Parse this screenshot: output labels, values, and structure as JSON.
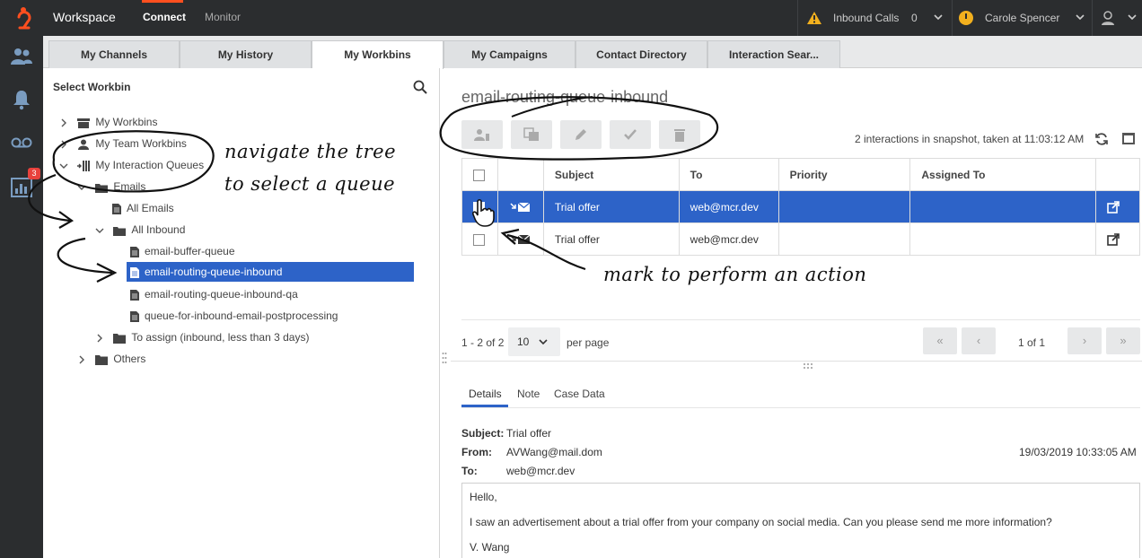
{
  "topbar": {
    "app_title": "Workspace",
    "tabs": [
      {
        "label": "Connect"
      },
      {
        "label": "Monitor"
      }
    ],
    "inbound_calls_label": "Inbound Calls",
    "inbound_calls_count": "0",
    "user_name": "Carole Spencer",
    "accent_color": "#ff4f1f"
  },
  "rail": {
    "icons": [
      "contacts-icon",
      "notifications-icon",
      "voicemail-icon",
      "dashboard-icon"
    ],
    "dashboard_badge": "3"
  },
  "workbin_tabs": [
    {
      "label": "My Channels"
    },
    {
      "label": "My History"
    },
    {
      "label": "My Workbins"
    },
    {
      "label": "My Campaigns"
    },
    {
      "label": "Contact Directory"
    },
    {
      "label": "Interaction Sear..."
    }
  ],
  "left_panel": {
    "title": "Select Workbin",
    "tree": [
      {
        "label": "My Workbins"
      },
      {
        "label": "My Team Workbins"
      },
      {
        "label": "My Interaction Queues"
      },
      {
        "label": "Emails"
      },
      {
        "label": "All Emails"
      },
      {
        "label": "All Inbound"
      },
      {
        "label": "email-buffer-queue"
      },
      {
        "label": "email-routing-queue-inbound"
      },
      {
        "label": "email-routing-queue-inbound-qa"
      },
      {
        "label": "queue-for-inbound-email-postprocessing"
      },
      {
        "label": "To assign (inbound, less than 3 days)"
      },
      {
        "label": "Others"
      }
    ]
  },
  "right_panel": {
    "title": "email-routing-queue-inbound",
    "snapshot_text": "2 interactions in snapshot, taken at 11:03:12 AM",
    "columns": [
      "Subject",
      "To",
      "Priority",
      "Assigned To"
    ],
    "rows": [
      {
        "subject": "Trial offer",
        "to": "web@mcr.dev",
        "priority": "",
        "assigned_to": ""
      },
      {
        "subject": "Trial offer",
        "to": "web@mcr.dev",
        "priority": "",
        "assigned_to": ""
      }
    ],
    "pager": {
      "range": "1 - 2 of 2",
      "page_size": "10",
      "per_page": "per page",
      "page_label": "1 of 1"
    },
    "detail_tabs": [
      {
        "label": "Details"
      },
      {
        "label": "Note"
      },
      {
        "label": "Case Data"
      }
    ],
    "details": {
      "subject_label": "Subject:",
      "subject_value": "Trial offer",
      "from_label": "From:",
      "from_value": "AVWang@mail.dom",
      "date": "19/03/2019 10:33:05 AM",
      "to_label": "To:",
      "to_value": "web@mcr.dev",
      "body": [
        "Hello,",
        "I saw an advertisement about a trial offer from your company on social media. Can you please send me more information?",
        "V. Wang"
      ]
    },
    "selection_color": "#2d63c8"
  },
  "annotations": {
    "tree_note_line1": "navigate the tree",
    "tree_note_line2": "to select a queue",
    "mark_note": "mark to perform an action"
  }
}
